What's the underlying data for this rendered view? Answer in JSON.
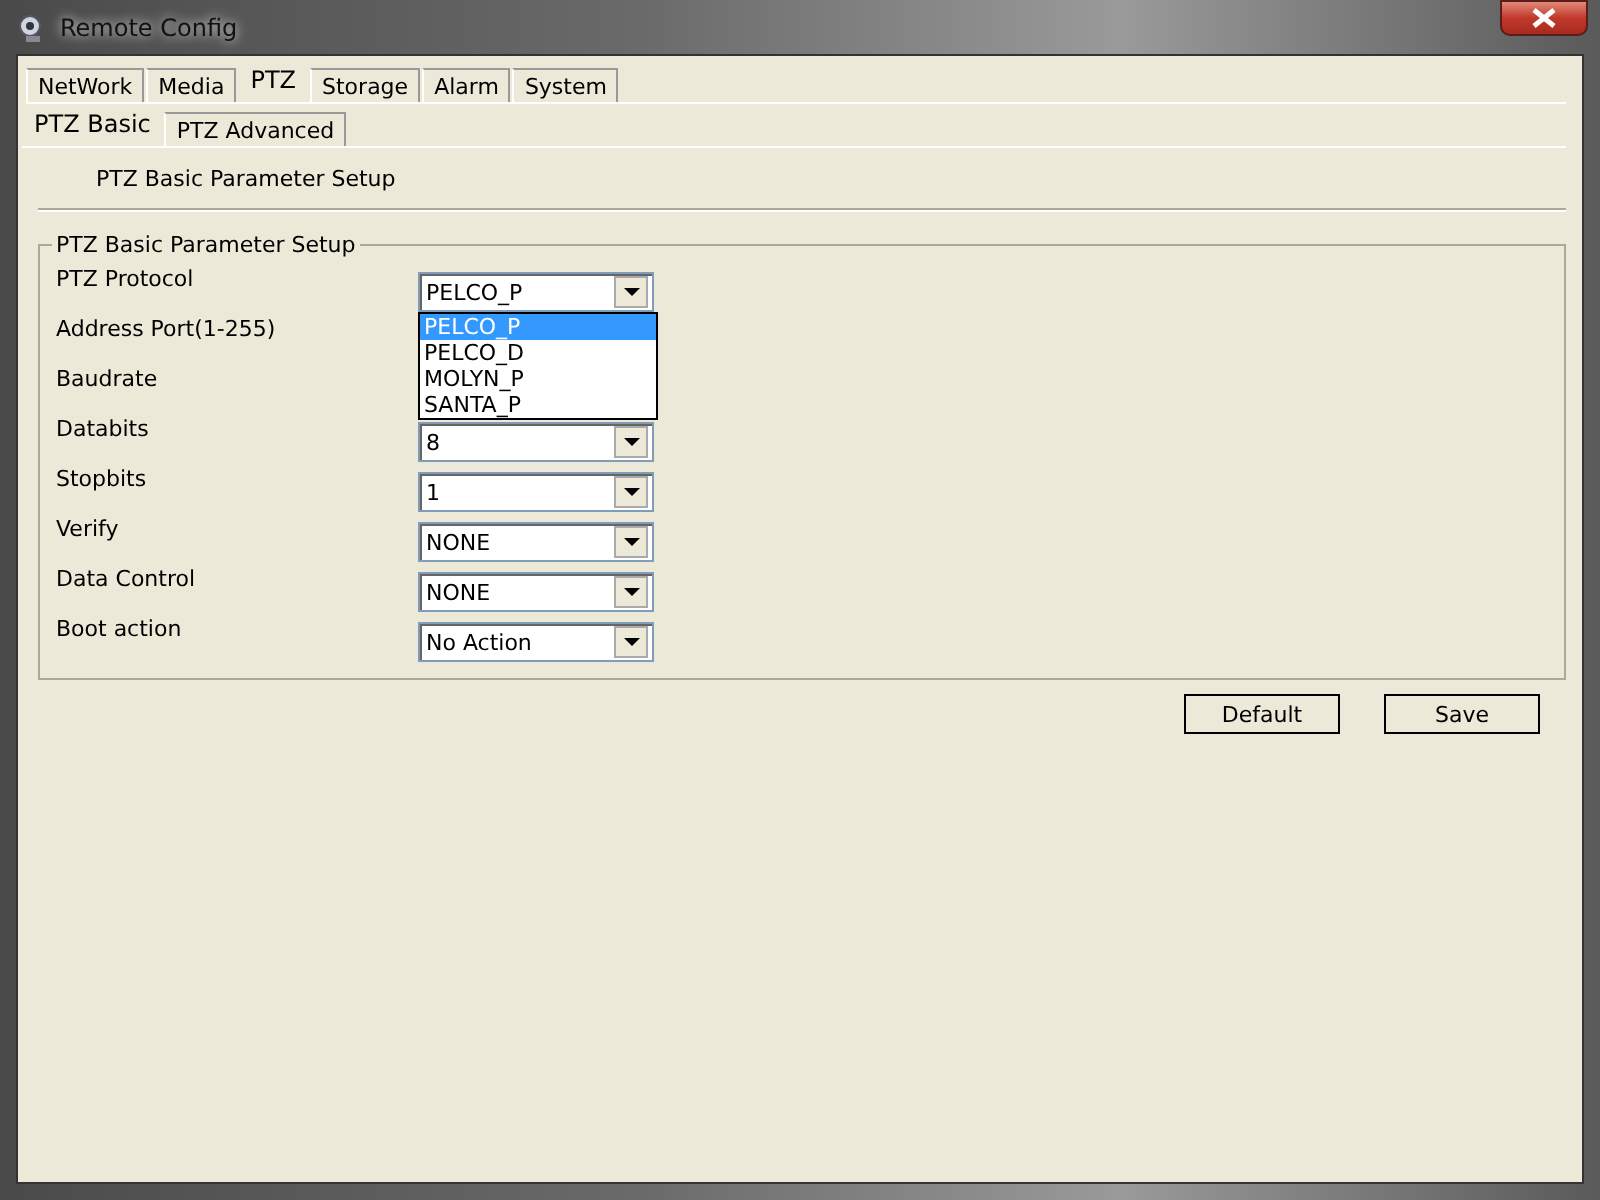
{
  "window": {
    "title": "Remote Config"
  },
  "tabs": [
    {
      "label": "NetWork",
      "selected": false
    },
    {
      "label": "Media",
      "selected": false
    },
    {
      "label": "PTZ",
      "selected": true
    },
    {
      "label": "Storage",
      "selected": false
    },
    {
      "label": "Alarm",
      "selected": false
    },
    {
      "label": "System",
      "selected": false
    }
  ],
  "subtabs": [
    {
      "label": "PTZ Basic",
      "selected": true
    },
    {
      "label": "PTZ Advanced",
      "selected": false
    }
  ],
  "heading": "PTZ Basic Parameter Setup",
  "group": {
    "title": "PTZ Basic Parameter Setup",
    "fields": [
      {
        "label": "PTZ Protocol",
        "value": "PELCO_P",
        "open": true,
        "options": [
          {
            "label": "PELCO_P",
            "selected": true
          },
          {
            "label": "PELCO_D",
            "selected": false
          },
          {
            "label": "MOLYN_P",
            "selected": false
          },
          {
            "label": "SANTA_P",
            "selected": false
          }
        ]
      },
      {
        "label": "Address Port(1-255)"
      },
      {
        "label": "Baudrate"
      },
      {
        "label": "Databits",
        "value": "8",
        "open": false
      },
      {
        "label": "Stopbits",
        "value": "1",
        "open": false
      },
      {
        "label": "Verify",
        "value": "NONE",
        "open": false
      },
      {
        "label": "Data Control",
        "value": "NONE",
        "open": false
      },
      {
        "label": "Boot action",
        "value": "No Action",
        "open": false
      }
    ]
  },
  "buttons": [
    "Default",
    "Save"
  ]
}
